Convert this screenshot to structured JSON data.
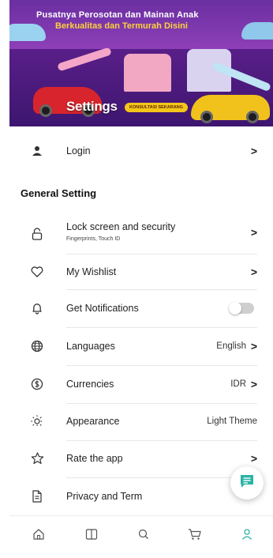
{
  "banner": {
    "headline": "Pusatnya Perosotan dan Mainan Anak",
    "subheadline": "Berkualitas dan Termurah Disini",
    "page_title": "Settings",
    "cta_pill": "KONSULTASI SEKARANG"
  },
  "login": {
    "label": "Login",
    "icon": "user-icon"
  },
  "section_title": "General Setting",
  "items": [
    {
      "label": "Lock screen and security",
      "sublabel": "Fingerprints, Touch ID",
      "icon": "lock-icon"
    },
    {
      "label": "My Wishlist",
      "icon": "heart-icon"
    },
    {
      "label": "Get Notifications",
      "icon": "bell-icon",
      "toggle": false
    },
    {
      "label": "Languages",
      "value": "English",
      "icon": "globe-icon"
    },
    {
      "label": "Currencies",
      "value": "IDR",
      "icon": "currency-icon"
    },
    {
      "label": "Appearance",
      "value": "Light Theme",
      "icon": "sun-icon"
    },
    {
      "label": "Rate the app",
      "icon": "star-icon"
    },
    {
      "label": "Privacy and Term",
      "icon": "document-icon"
    }
  ],
  "chevron": ">",
  "colors": {
    "accent": "#2bb3a6",
    "nav_icon": "#555555"
  },
  "nav": [
    "home-icon",
    "catalog-icon",
    "search-icon",
    "cart-icon",
    "profile-icon"
  ]
}
